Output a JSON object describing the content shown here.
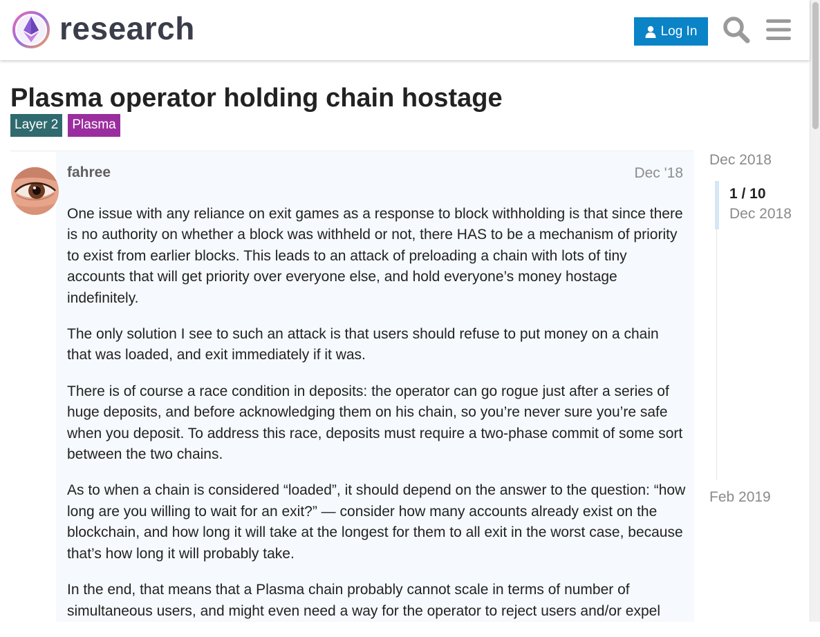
{
  "header": {
    "logo_text": "research",
    "login_label": "Log In",
    "accent_color": "#0a83c7"
  },
  "topic": {
    "title": "Plasma operator holding chain hostage",
    "tags": [
      {
        "label": "Layer 2",
        "color": "#2e6a6e"
      },
      {
        "label": "Plasma",
        "color": "#9b2e9e"
      }
    ]
  },
  "post": {
    "username": "fahree",
    "date": "Dec '18",
    "paragraphs": [
      "One issue with any reliance on exit games as a response to block withholding is that since there is no authority on whether a block was withheld or not, there HAS to be a mechanism of priority to exist from earlier blocks. This leads to an attack of preloading a chain with lots of tiny accounts that will get priority over everyone else, and hold everyone’s money hostage indefinitely.",
      "The only solution I see to such an attack is that users should refuse to put money on a chain that was loaded, and exit immediately if it was.",
      "There is of course a race condition in deposits: the operator can go rogue just after a series of huge deposits, and before acknowledging them on his chain, so you’re never sure you’re safe when you deposit. To address this race, deposits must require a two-phase commit of some sort between the two chains.",
      "As to when a chain is considered “loaded”, it should depend on the answer to the question: “how long are you willing to wait for an exit?” — consider how many accounts already exist on the blockchain, and how long it will take at the longest for them to all exit in the worst case, because that’s how long it will probably take.",
      "In the end, that means that a Plasma chain probably cannot scale in terms of number of simultaneous users, and might even need a way for the operator to reject users and/or expel"
    ]
  },
  "timeline": {
    "start_label": "Dec 2018",
    "position": "1 / 10",
    "current_date": "Dec 2018",
    "end_label": "Feb 2019"
  },
  "icons": {
    "login": "user-icon",
    "search": "search-icon",
    "menu": "hamburger-menu-icon",
    "logo": "ethereum-research-logo"
  }
}
